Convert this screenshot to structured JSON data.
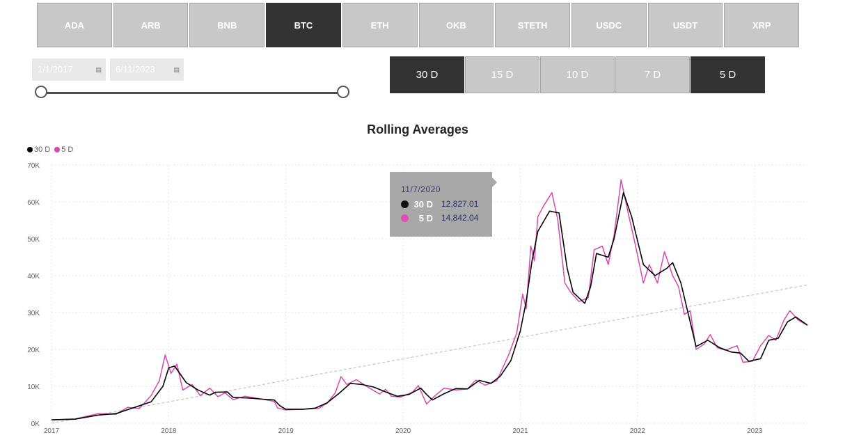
{
  "coins": [
    {
      "label": "ADA",
      "active": false
    },
    {
      "label": "ARB",
      "active": false
    },
    {
      "label": "BNB",
      "active": false
    },
    {
      "label": "BTC",
      "active": true
    },
    {
      "label": "ETH",
      "active": false
    },
    {
      "label": "OKB",
      "active": false
    },
    {
      "label": "STETH",
      "active": false
    },
    {
      "label": "USDC",
      "active": false
    },
    {
      "label": "USDT",
      "active": false
    },
    {
      "label": "XRP",
      "active": false
    }
  ],
  "date_range": {
    "start": "1/1/2017",
    "end": "6/11/2023"
  },
  "periods": [
    {
      "label": "30 D",
      "active": true
    },
    {
      "label": "15 D",
      "active": false
    },
    {
      "label": "10 D",
      "active": false
    },
    {
      "label": "7 D",
      "active": false
    },
    {
      "label": "5 D",
      "active": true
    }
  ],
  "tooltip": {
    "date": "11/7/2020",
    "rows": [
      {
        "label": "30 D",
        "value": "12,827.01",
        "color": "#111111"
      },
      {
        "label": "5 D",
        "value": "14,842.04",
        "color": "#e04fb5"
      }
    ]
  },
  "colors": {
    "series_30d": "#000000",
    "series_5d": "#d946b0",
    "trend": "#c8c8c8",
    "active": "#333333",
    "inactive": "#c8c8c8"
  },
  "chart_data": {
    "type": "line",
    "title": "Rolling Averages",
    "legend": {
      "placement": "top-left",
      "entries": [
        "30 D",
        "5 D"
      ]
    },
    "xlim": [
      2017.0,
      2023.45
    ],
    "ylim": [
      0,
      70000
    ],
    "xticks": [
      "2017",
      "2018",
      "2019",
      "2020",
      "2021",
      "2022",
      "2023"
    ],
    "yticks": [
      "0K",
      "10K",
      "20K",
      "30K",
      "40K",
      "50K",
      "60K",
      "70K"
    ],
    "grid": true,
    "trendline": {
      "x": [
        2017.0,
        2023.45
      ],
      "y": [
        -1000,
        37500
      ]
    },
    "series": [
      {
        "name": "30 D",
        "color": "#000000",
        "points": [
          [
            2017.0,
            900
          ],
          [
            2017.2,
            1100
          ],
          [
            2017.4,
            2200
          ],
          [
            2017.55,
            2600
          ],
          [
            2017.7,
            4200
          ],
          [
            2017.85,
            5800
          ],
          [
            2017.95,
            10000
          ],
          [
            2018.0,
            15000
          ],
          [
            2018.05,
            15500
          ],
          [
            2018.15,
            11000
          ],
          [
            2018.25,
            9000
          ],
          [
            2018.35,
            7600
          ],
          [
            2018.4,
            8400
          ],
          [
            2018.5,
            8500
          ],
          [
            2018.55,
            7000
          ],
          [
            2018.7,
            6800
          ],
          [
            2018.8,
            6500
          ],
          [
            2018.9,
            6300
          ],
          [
            2018.95,
            4700
          ],
          [
            2019.0,
            3800
          ],
          [
            2019.15,
            3800
          ],
          [
            2019.25,
            4100
          ],
          [
            2019.35,
            5500
          ],
          [
            2019.45,
            8000
          ],
          [
            2019.55,
            10800
          ],
          [
            2019.65,
            10500
          ],
          [
            2019.75,
            9800
          ],
          [
            2019.85,
            8500
          ],
          [
            2019.95,
            7300
          ],
          [
            2020.05,
            7800
          ],
          [
            2020.15,
            9500
          ],
          [
            2020.2,
            7800
          ],
          [
            2020.25,
            6300
          ],
          [
            2020.35,
            8000
          ],
          [
            2020.45,
            9400
          ],
          [
            2020.55,
            9300
          ],
          [
            2020.65,
            11600
          ],
          [
            2020.75,
            10800
          ],
          [
            2020.83,
            12800
          ],
          [
            2020.92,
            17000
          ],
          [
            2021.0,
            25000
          ],
          [
            2021.05,
            33000
          ],
          [
            2021.1,
            44000
          ],
          [
            2021.15,
            52000
          ],
          [
            2021.25,
            57500
          ],
          [
            2021.33,
            57000
          ],
          [
            2021.4,
            42000
          ],
          [
            2021.45,
            35500
          ],
          [
            2021.55,
            32500
          ],
          [
            2021.6,
            37000
          ],
          [
            2021.65,
            46000
          ],
          [
            2021.75,
            45000
          ],
          [
            2021.8,
            50000
          ],
          [
            2021.88,
            62500
          ],
          [
            2021.95,
            56000
          ],
          [
            2022.05,
            43000
          ],
          [
            2022.15,
            40000
          ],
          [
            2022.25,
            42000
          ],
          [
            2022.3,
            43500
          ],
          [
            2022.37,
            38000
          ],
          [
            2022.43,
            30000
          ],
          [
            2022.5,
            20800
          ],
          [
            2022.6,
            22500
          ],
          [
            2022.7,
            20500
          ],
          [
            2022.8,
            19300
          ],
          [
            2022.88,
            19000
          ],
          [
            2022.95,
            16800
          ],
          [
            2023.05,
            17500
          ],
          [
            2023.12,
            22500
          ],
          [
            2023.2,
            23000
          ],
          [
            2023.28,
            27500
          ],
          [
            2023.35,
            28800
          ],
          [
            2023.45,
            26600
          ]
        ]
      },
      {
        "name": "5 D",
        "color": "#d946b0",
        "points": [
          [
            2017.0,
            950
          ],
          [
            2017.2,
            1150
          ],
          [
            2017.4,
            2600
          ],
          [
            2017.55,
            2400
          ],
          [
            2017.65,
            4300
          ],
          [
            2017.75,
            4000
          ],
          [
            2017.85,
            7500
          ],
          [
            2017.92,
            11500
          ],
          [
            2017.97,
            18500
          ],
          [
            2018.02,
            13500
          ],
          [
            2018.07,
            16000
          ],
          [
            2018.12,
            9000
          ],
          [
            2018.2,
            10500
          ],
          [
            2018.27,
            7500
          ],
          [
            2018.35,
            9500
          ],
          [
            2018.42,
            7200
          ],
          [
            2018.48,
            8200
          ],
          [
            2018.55,
            6400
          ],
          [
            2018.65,
            7300
          ],
          [
            2018.8,
            6500
          ],
          [
            2018.9,
            5900
          ],
          [
            2018.93,
            4100
          ],
          [
            2019.0,
            3600
          ],
          [
            2019.15,
            3800
          ],
          [
            2019.28,
            4000
          ],
          [
            2019.35,
            5400
          ],
          [
            2019.42,
            8200
          ],
          [
            2019.47,
            12600
          ],
          [
            2019.52,
            10500
          ],
          [
            2019.6,
            11800
          ],
          [
            2019.7,
            9800
          ],
          [
            2019.8,
            7900
          ],
          [
            2019.85,
            9200
          ],
          [
            2019.9,
            7300
          ],
          [
            2019.98,
            7100
          ],
          [
            2020.08,
            8400
          ],
          [
            2020.13,
            10200
          ],
          [
            2020.2,
            5200
          ],
          [
            2020.27,
            7400
          ],
          [
            2020.35,
            9500
          ],
          [
            2020.45,
            9000
          ],
          [
            2020.55,
            9300
          ],
          [
            2020.62,
            11700
          ],
          [
            2020.7,
            10300
          ],
          [
            2020.8,
            11500
          ],
          [
            2020.85,
            15000
          ],
          [
            2020.9,
            18500
          ],
          [
            2020.97,
            24500
          ],
          [
            2021.02,
            35000
          ],
          [
            2021.05,
            31000
          ],
          [
            2021.09,
            48000
          ],
          [
            2021.12,
            44000
          ],
          [
            2021.15,
            56000
          ],
          [
            2021.2,
            59000
          ],
          [
            2021.27,
            62500
          ],
          [
            2021.32,
            55000
          ],
          [
            2021.38,
            38000
          ],
          [
            2021.43,
            35500
          ],
          [
            2021.5,
            33000
          ],
          [
            2021.58,
            34000
          ],
          [
            2021.63,
            47000
          ],
          [
            2021.7,
            48000
          ],
          [
            2021.75,
            43000
          ],
          [
            2021.8,
            51000
          ],
          [
            2021.86,
            66000
          ],
          [
            2021.92,
            57000
          ],
          [
            2021.97,
            50000
          ],
          [
            2022.05,
            38000
          ],
          [
            2022.1,
            43000
          ],
          [
            2022.17,
            38000
          ],
          [
            2022.23,
            46500
          ],
          [
            2022.3,
            40000
          ],
          [
            2022.35,
            37000
          ],
          [
            2022.4,
            29500
          ],
          [
            2022.45,
            30500
          ],
          [
            2022.5,
            20000
          ],
          [
            2022.57,
            21500
          ],
          [
            2022.62,
            24000
          ],
          [
            2022.68,
            20500
          ],
          [
            2022.75,
            19800
          ],
          [
            2022.85,
            21000
          ],
          [
            2022.9,
            16500
          ],
          [
            2022.98,
            16800
          ],
          [
            2023.05,
            21000
          ],
          [
            2023.12,
            23800
          ],
          [
            2023.18,
            22500
          ],
          [
            2023.25,
            28000
          ],
          [
            2023.3,
            30500
          ],
          [
            2023.37,
            28000
          ],
          [
            2023.45,
            26500
          ]
        ]
      }
    ]
  }
}
